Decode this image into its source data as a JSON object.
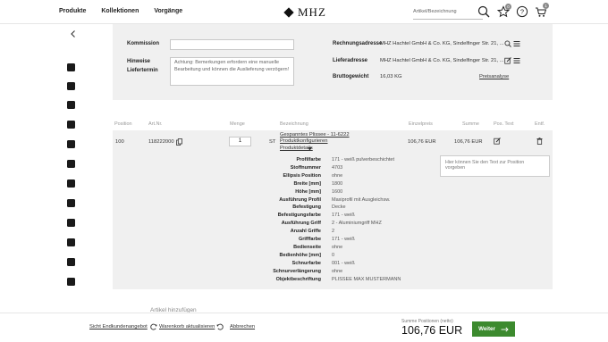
{
  "header": {
    "nav": [
      "Produkte",
      "Kollektionen",
      "Vorgänge"
    ],
    "logo_text": "MHZ",
    "search_placeholder": "Artikel/Bezeichnung",
    "favorites_count": "0",
    "cart_count": "1"
  },
  "sidebar": {
    "icons": [
      "back-icon",
      "roller-blind-icon",
      "blind-icon",
      "venetian-blind-icon",
      "pleated-blind-icon",
      "curtain-icon",
      "panel-icon",
      "vertical-blind-icon",
      "awning-icon",
      "rail-icon",
      "track-icon",
      "fabric-icon",
      "accessory-icon",
      "misc-icon"
    ]
  },
  "order": {
    "kommission_label": "Kommission",
    "kommission_value": "",
    "hinweise_label": "Hinweise",
    "liefertermin_label": "Liefertermin",
    "hinweise_note": "Achtung: Bemerkungen erfordern eine manuelle Bearbeitung und können die Auslieferung verzögern!",
    "rechnungsadresse_label": "Rechnungsadresse",
    "rechnungsadresse_value": "MHZ Hachtel GmbH & Co. KG, Sindelfinger Str. 21, ...",
    "lieferadresse_label": "Lieferadresse",
    "lieferadresse_value": "MHZ Hachtel GmbH & Co. KG, Sindelfinger Str. 21, ...",
    "bruttogewicht_label": "Bruttogewicht",
    "bruttogewicht_value": "16,03 KG",
    "preisanalyse_label": "Preisanalyse"
  },
  "table": {
    "headers": {
      "position": "Position",
      "artnr": "Art.Nr.",
      "menge": "Menge",
      "bezeichnung": "Bezeichnung",
      "einzelpreis": "Einzelpreis",
      "summe": "Summe",
      "pos_text": "Pos. Text",
      "entf": "Entf."
    },
    "row": {
      "position": "100",
      "artnr": "118222000",
      "menge": "1",
      "unit": "ST",
      "bez_title": "Gespanntes Plissee - 11-6222",
      "bez_config": "Produktkonfigurieren",
      "bez_details": "Produktdetails",
      "einzelpreis": "106,76 EUR",
      "summe": "106,76 EUR",
      "postext_placeholder": "Hier können Sie den Text zur Position vorgeben",
      "attributes": [
        {
          "label": "Profilfarbe",
          "value": "171 - weiß pulverbeschichtet"
        },
        {
          "label": "Stoffnummer",
          "value": "4703"
        },
        {
          "label": "Ellipsis Position",
          "value": "ohne"
        },
        {
          "label": "Breite [mm]",
          "value": "1800"
        },
        {
          "label": "Höhe [mm]",
          "value": "1600"
        },
        {
          "label": "Ausführung Profil",
          "value": "Maxiprofil mit Ausgleichsw."
        },
        {
          "label": "Befestigung",
          "value": "Decke"
        },
        {
          "label": "Befestigungsfarbe",
          "value": "171 - weiß"
        },
        {
          "label": "Ausführung Griff",
          "value": "2 - Aluminiumgriff MHZ"
        },
        {
          "label": "Anzahl Griffe",
          "value": "2"
        },
        {
          "label": "Grifffarbe",
          "value": "171 - weiß"
        },
        {
          "label": "Bedienseite",
          "value": "ohne"
        },
        {
          "label": "Bedienhöhe [mm]",
          "value": "0"
        },
        {
          "label": "Schnurfarbe",
          "value": "001 - weiß"
        },
        {
          "label": "Schnurverlängerung",
          "value": "ohne"
        },
        {
          "label": "Objektbeschriftung",
          "value": "PLISSEE MAX MUSTERMANN"
        }
      ]
    }
  },
  "add_article": "Artikel hinzufügen",
  "footer": {
    "links": [
      "Sicht Endkundenangebot",
      "Warenkorb aktualisieren",
      "Abbrechen"
    ],
    "sum_label": "Summe Positionen (netto)",
    "sum_value": "106,76 EUR",
    "next_label": "Weiter"
  },
  "colors": {
    "accent": "#3c8a2e",
    "panel": "#f0f0f0"
  }
}
